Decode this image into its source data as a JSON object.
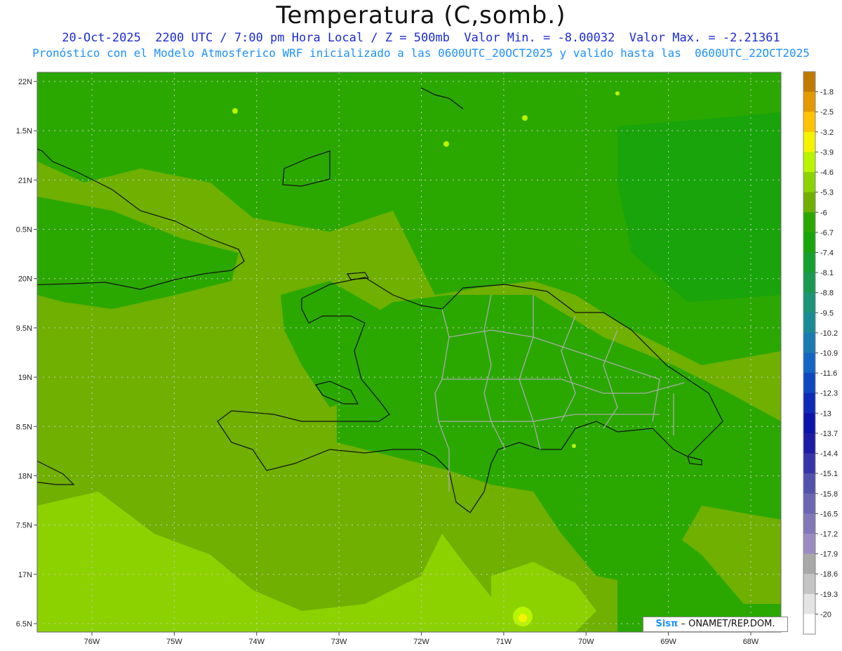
{
  "title": "Temperatura (C,somb.)",
  "subtitle_line1": "20-Oct-2025  2200 UTC / 7:00 pm Hora Local / Z = 500mb  Valor Min. = -8.00032  Valor Max. = -2.21361",
  "subtitle_line2": "Pronóstico con el Modelo Atmosferico WRF inicializado a las 0600UTC_20OCT2025 y valido hasta las  0600UTC_22OCT2025",
  "credit": {
    "logo": "Sisπ",
    "text": "– ONAMET/REP.DOM."
  },
  "map_data": {
    "lat_labels": [
      "22N",
      "1.5N",
      "21N",
      "0.5N",
      "20N",
      "9.5N",
      "19N",
      "8.5N",
      "18N",
      "7.5N",
      "17N",
      "6.5N"
    ],
    "lon_labels": [
      "76W",
      "75W",
      "74W",
      "73W",
      "72W",
      "71W",
      "70W",
      "69W",
      "68W"
    ],
    "colorbar": {
      "labels": [
        "-1.8",
        "-2.5",
        "-3.2",
        "-3.9",
        "-4.6",
        "-5.3",
        "-6",
        "-6.7",
        "-7.4",
        "-8.1",
        "-8.8",
        "-9.5",
        "-10.2",
        "-10.9",
        "-11.6",
        "-12.3",
        "-13",
        "-13.7",
        "-14.4",
        "-15.1",
        "-15.8",
        "-16.5",
        "-17.2",
        "-17.9",
        "-18.6",
        "-19.3",
        "-20"
      ],
      "colors": [
        "#c07a00",
        "#e39a00",
        "#ffc400",
        "#f4f400",
        "#b9f400",
        "#8cd200",
        "#6fb000",
        "#2aa800",
        "#18a40a",
        "#14a030",
        "#1a9a50",
        "#1b9478",
        "#1a8a94",
        "#1a7ab2",
        "#1464c4",
        "#1046c0",
        "#0e2ab6",
        "#0a14aa",
        "#1c1ca6",
        "#3634a8",
        "#5252ac",
        "#6a66b2",
        "#8278b8",
        "#9a8cc0",
        "#a8a8a8",
        "#c4c4c4",
        "#e4e4e4",
        "#ffffff"
      ]
    }
  }
}
